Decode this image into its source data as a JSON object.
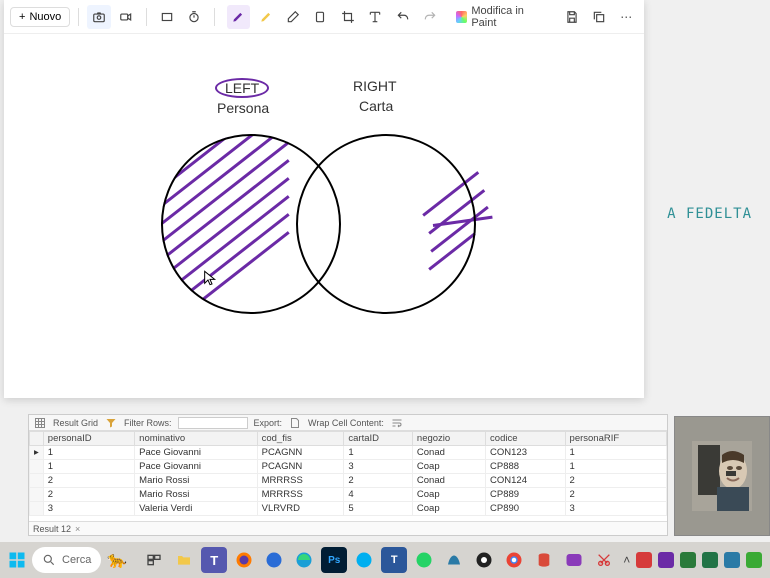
{
  "snip": {
    "nuovo": "Nuovo",
    "modifica_paint": "Modifica in Paint",
    "diagram": {
      "left_top": "LEFT",
      "left_bottom": "Persona",
      "right_top": "RIGHT",
      "right_bottom": "Carta"
    }
  },
  "bg": {
    "text": "A FEDELTA"
  },
  "sql": {
    "result_grid": "Result Grid",
    "filter_rows": "Filter Rows:",
    "export": "Export:",
    "wrap_cell": "Wrap Cell Content:",
    "columns": [
      "personaID",
      "nominativo",
      "cod_fis",
      "cartaID",
      "negozio",
      "codice",
      "personaRIF"
    ],
    "rows": [
      [
        "1",
        "Pace Giovanni",
        "PCAGNN",
        "1",
        "Conad",
        "CON123",
        "1"
      ],
      [
        "1",
        "Pace Giovanni",
        "PCAGNN",
        "3",
        "Coap",
        "CP888",
        "1"
      ],
      [
        "2",
        "Mario Rossi",
        "MRRRSS",
        "2",
        "Conad",
        "CON124",
        "2"
      ],
      [
        "2",
        "Mario Rossi",
        "MRRRSS",
        "4",
        "Coap",
        "CP889",
        "2"
      ],
      [
        "3",
        "Valeria Verdi",
        "VLRVRD",
        "5",
        "Coap",
        "CP890",
        "3"
      ]
    ],
    "foot_tab": "Result 12",
    "foot_close": "×"
  },
  "taskbar": {
    "search": "Cerca"
  }
}
